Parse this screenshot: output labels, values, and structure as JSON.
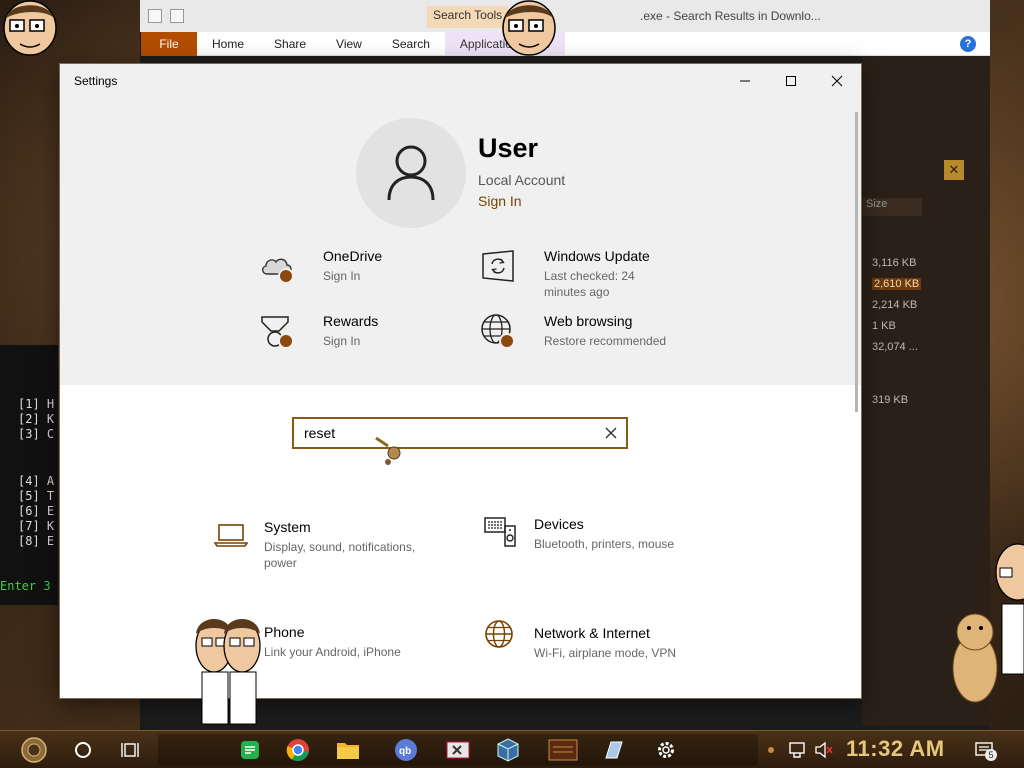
{
  "background_explorer": {
    "tab_search_tools": "Search Tools",
    "tab_application_tools": "Application Tools",
    "title": ".exe - Search Results in Downlo...",
    "ribbon": {
      "file": "File",
      "home": "Home",
      "share": "Share",
      "view": "View",
      "search": "Search",
      "application_tools": "Application Tools"
    },
    "column_size": "Size",
    "sizes": [
      "3,116 KB",
      "2,610 KB",
      "2,214 KB",
      "1 KB",
      "32,074 ...",
      "319 KB"
    ],
    "console_lines": [
      "[1] H",
      "[2] K",
      "[3] C",
      "[4] A",
      "[5] T",
      "[6] E",
      "[7] K",
      "[8] E",
      "Enter 3"
    ]
  },
  "settings": {
    "window_title": "Settings",
    "user": {
      "name": "User",
      "account_type": "Local Account",
      "sign_in": "Sign In"
    },
    "tiles": [
      {
        "name": "OneDrive",
        "sub": "Sign In"
      },
      {
        "name": "Windows Update",
        "sub": "Last checked: 24 minutes ago"
      },
      {
        "name": "Rewards",
        "sub": "Sign In"
      },
      {
        "name": "Web browsing",
        "sub": "Restore recommended"
      }
    ],
    "search": {
      "value": "reset"
    },
    "categories": [
      {
        "name": "System",
        "sub": "Display, sound, notifications, power"
      },
      {
        "name": "Devices",
        "sub": "Bluetooth, printers, mouse"
      },
      {
        "name": "Phone",
        "sub": "Link your Android, iPhone"
      },
      {
        "name": "Network & Internet",
        "sub": "Wi-Fi, airplane mode, VPN"
      }
    ]
  },
  "taskbar": {
    "clock": "11:32 AM",
    "notification_count": "5"
  },
  "colors": {
    "accent": "#8a5a14",
    "sign_in_link": "#7a4200",
    "badge": "#8a4a0e"
  }
}
